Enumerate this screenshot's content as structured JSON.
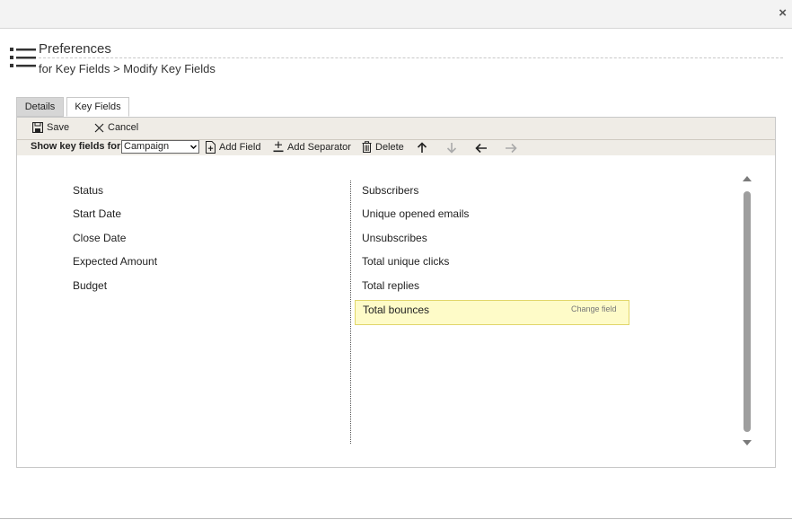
{
  "window": {
    "close_glyph": "×"
  },
  "header": {
    "title": "Preferences",
    "subtitle": "for Key Fields > Modify Key Fields",
    "icon": "list-icon"
  },
  "tabs": [
    {
      "label": "Details"
    },
    {
      "label": "Key Fields",
      "active": true
    }
  ],
  "toolbar": {
    "save_label": "Save",
    "cancel_label": "Cancel",
    "show_label": "Show key fields for",
    "select_value": "Campaign",
    "add_field_label": "Add Field",
    "add_separator_label": "Add Separator",
    "delete_label": "Delete"
  },
  "left_fields": [
    "Status",
    "Start Date",
    "Close Date",
    "Expected Amount",
    "Budget"
  ],
  "right_fields": [
    "Subscribers",
    "Unique opened emails",
    "Unsubscribes",
    "Total unique clicks",
    "Total replies",
    "Total bounces"
  ],
  "selected": {
    "field": "Total bounces",
    "action": "Change field"
  },
  "colors": {
    "toolbar_bg": "#efece6",
    "highlight_bg": "#fefbc8",
    "highlight_border": "#e1d66a"
  }
}
